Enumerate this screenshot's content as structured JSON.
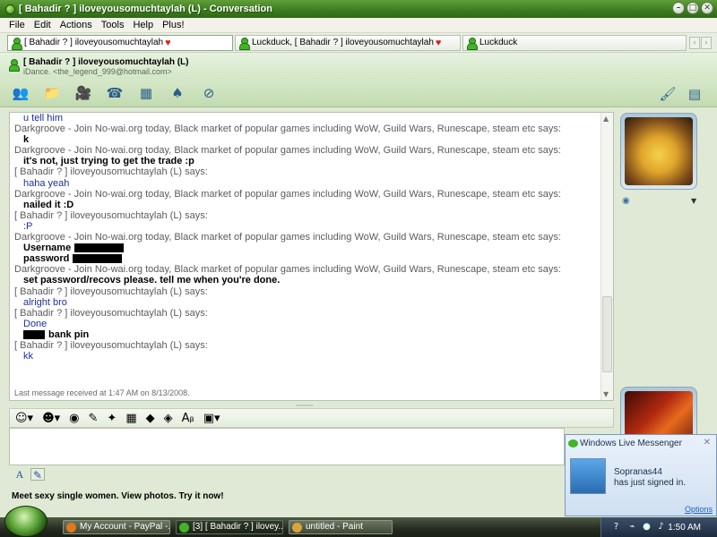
{
  "window": {
    "title": "[ Bahadir ? ] iloveyousomuchtaylah (L) - Conversation"
  },
  "menu": [
    "File",
    "Edit",
    "Actions",
    "Tools",
    "Help",
    "Plus!"
  ],
  "tabs": [
    {
      "label": "[ Bahadir ? ] iloveyousomuchtaylah",
      "heart": true
    },
    {
      "label": "Luckduck, [ Bahadir ? ] iloveyousomuchtaylah",
      "heart": true
    },
    {
      "label": "Luckduck",
      "heart": false
    }
  ],
  "contact": {
    "name": "[ Bahadir ? ] iloveyousomuchtaylah (L)",
    "sub": "iDance. <the_legend_999@hotmail.com>"
  },
  "messages": [
    {
      "kind": "body",
      "text": "u tell him"
    },
    {
      "kind": "hdr",
      "text": "Darkgroove - Join No-wai.org today, Black market of popular games including WoW, Guild Wars, Runescape, steam etc says:"
    },
    {
      "kind": "body bold",
      "text": "k"
    },
    {
      "kind": "hdr",
      "text": "Darkgroove - Join No-wai.org today, Black market of popular games including WoW, Guild Wars, Runescape, steam etc says:"
    },
    {
      "kind": "body bold",
      "text": "it's not, just trying to get the trade :p"
    },
    {
      "kind": "hdr",
      "text": "[ Bahadir ? ] iloveyousomuchtaylah (L) says:"
    },
    {
      "kind": "body",
      "text": "haha yeah"
    },
    {
      "kind": "hdr",
      "text": "Darkgroove - Join No-wai.org today, Black market of popular games including WoW, Guild Wars, Runescape, steam etc says:"
    },
    {
      "kind": "body bold",
      "text": "nailed it :D"
    },
    {
      "kind": "hdr",
      "text": "[ Bahadir ? ] iloveyousomuchtaylah (L) says:"
    },
    {
      "kind": "body",
      "text": ":P"
    },
    {
      "kind": "hdr",
      "text": "Darkgroove - Join No-wai.org today, Black market of popular games including WoW, Guild Wars, Runescape, steam etc says:"
    },
    {
      "kind": "body bold",
      "text": "Username",
      "redact": "after"
    },
    {
      "kind": "body bold",
      "text": "password",
      "redact": "after"
    },
    {
      "kind": "hdr",
      "text": "Darkgroove - Join No-wai.org today, Black market of popular games including WoW, Guild Wars, Runescape, steam etc says:"
    },
    {
      "kind": "body bold",
      "text": "set password/recovs please. tell me when you're done."
    },
    {
      "kind": "hdr",
      "text": "[ Bahadir ? ] iloveyousomuchtaylah (L) says:"
    },
    {
      "kind": "body",
      "text": "alright bro"
    },
    {
      "kind": "hdr",
      "text": "[ Bahadir ? ] iloveyousomuchtaylah (L) says:"
    },
    {
      "kind": "body",
      "text": "Done"
    },
    {
      "kind": "body bold",
      "text": "bank pin",
      "redact": "before"
    },
    {
      "kind": "hdr",
      "text": "[ Bahadir ? ] iloveyousomuchtaylah (L) says:"
    },
    {
      "kind": "body",
      "text": "kk"
    }
  ],
  "last_message": "Last message received at 1:47 AM on 8/13/2008.",
  "ad_text": "Meet sexy single women. View photos. Try it now!",
  "notification": {
    "title": "Windows Live Messenger",
    "name": "Sopranas44",
    "status": "has just signed in.",
    "options": "Options"
  },
  "taskbar": {
    "tasks": [
      {
        "label": "My Account - PayPal -...",
        "color": "#e0781e"
      },
      {
        "label": "[3] [ Bahadir ? ] ilovey...",
        "color": "#43b32a"
      },
      {
        "label": "untitled - Paint",
        "color": "#d9a43a"
      }
    ],
    "clock": "1:50 AM"
  },
  "colors": {
    "accent": "#3b7a1e",
    "msg_body": "#1e2f9e"
  }
}
